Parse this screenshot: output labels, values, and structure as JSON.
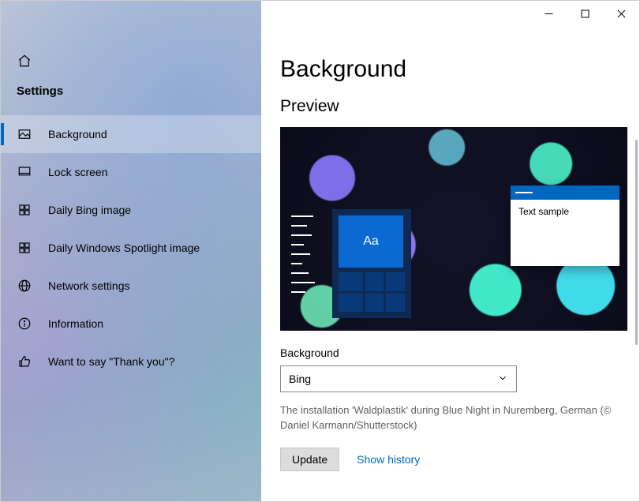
{
  "window": {
    "minimize_name": "minimize",
    "maximize_name": "maximize",
    "close_name": "close"
  },
  "sidebar": {
    "settings_label": "Settings",
    "items": [
      {
        "label": "Background",
        "icon": "picture-icon",
        "active": true
      },
      {
        "label": "Lock screen",
        "icon": "monitor-icon",
        "active": false
      },
      {
        "label": "Daily Bing image",
        "icon": "grid-icon",
        "active": false
      },
      {
        "label": "Daily Windows Spotlight image",
        "icon": "grid-icon",
        "active": false
      },
      {
        "label": "Network settings",
        "icon": "globe-icon",
        "active": false
      },
      {
        "label": "Information",
        "icon": "info-icon",
        "active": false
      },
      {
        "label": "Want to say \"Thank you\"?",
        "icon": "thumbs-up-icon",
        "active": false
      }
    ]
  },
  "main": {
    "title": "Background",
    "preview_heading": "Preview",
    "preview_window_text": "Text sample",
    "preview_tile_text": "Aa",
    "background_field_label": "Background",
    "background_select_value": "Bing",
    "caption": "The installation 'Waldplastik' during Blue Night in Nuremberg, German (© Daniel Karmann/Shutterstock)",
    "update_button": "Update",
    "show_history_link": "Show history"
  },
  "colors": {
    "accent": "#0067c0"
  }
}
